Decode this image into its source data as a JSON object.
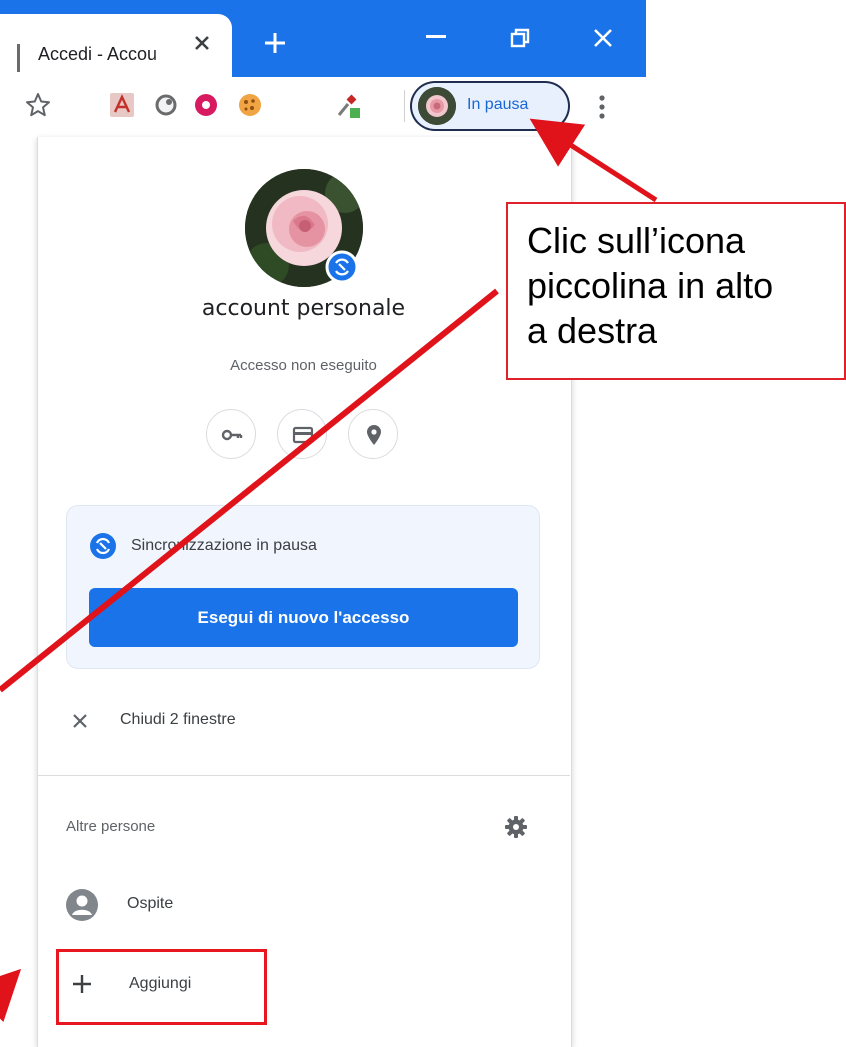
{
  "window": {
    "tab_title": "Accedi - Accou",
    "tab_close_icon": "close-icon",
    "new_tab_icon": "plus-icon",
    "minimize_icon": "minimize-icon",
    "restore_icon": "restore-icon",
    "close_icon": "close-icon",
    "accent_color": "#1a73e8"
  },
  "toolbar": {
    "icons": [
      "star-icon",
      "pdf-extension-icon",
      "circle-extension-icon",
      "flower-extension-icon",
      "cookie-extension-icon",
      "eyedropper-extension-icon"
    ],
    "profile_button_label": "In pausa",
    "menu_icon": "kebab-menu-icon"
  },
  "profile_menu": {
    "account_name": "account personale",
    "account_status": "Accesso non eseguito",
    "quick_actions": [
      "key-icon",
      "card-icon",
      "location-icon"
    ],
    "sync": {
      "message": "Sincronizzazione in pausa",
      "button_label": "Esegui di nuovo l'accesso",
      "icon": "sync-paused-icon"
    },
    "close_windows_label": "Chiudi 2 finestre",
    "other_people_label": "Altre persone",
    "settings_icon": "gear-icon",
    "guest_label": "Ospite",
    "add_label": "Aggiungi"
  },
  "annotation": {
    "callout_lines": [
      "Clic sull’icona",
      "piccolina in alto",
      "a destra"
    ],
    "highlight_color": "#e8171f"
  }
}
